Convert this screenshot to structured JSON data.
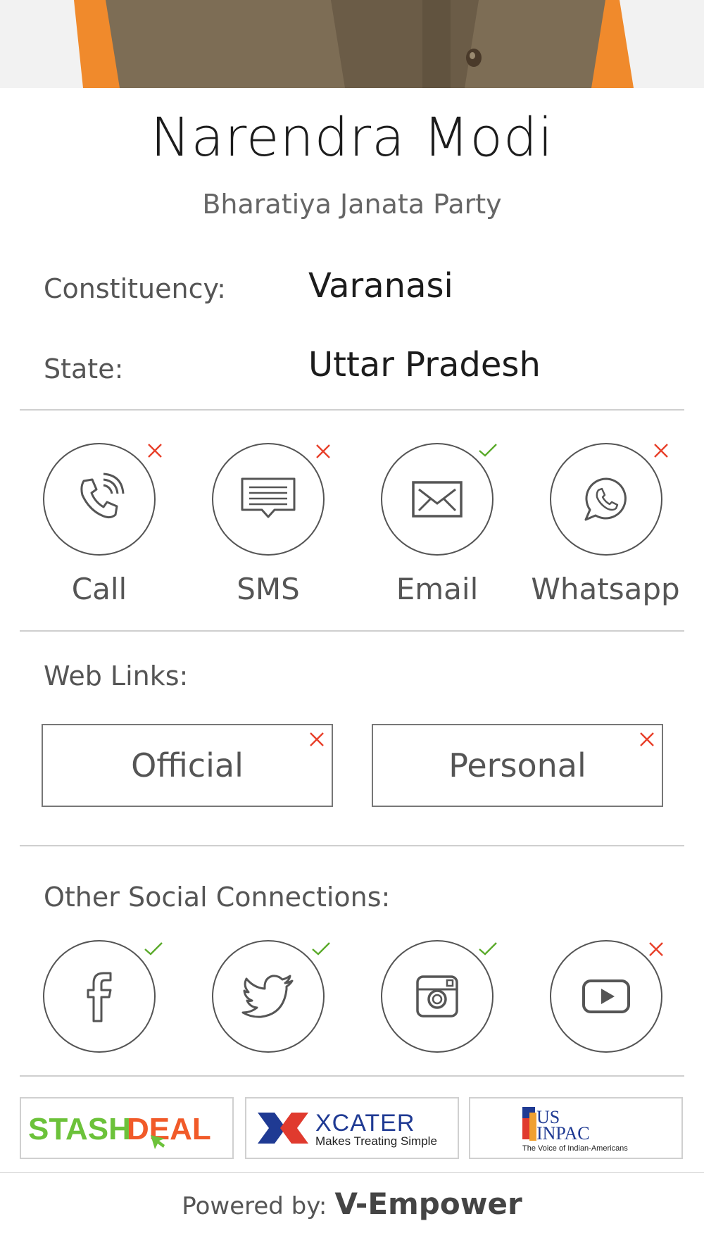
{
  "profile": {
    "name": "Narendra Modi",
    "party": "Bharatiya Janata Party",
    "constituency_label": "Constituency:",
    "constituency_value": "Varanasi",
    "state_label": "State:",
    "state_value": "Uttar Pradesh"
  },
  "contact": {
    "items": [
      {
        "label": "Call",
        "icon": "phone-icon",
        "available": false
      },
      {
        "label": "SMS",
        "icon": "sms-icon",
        "available": false
      },
      {
        "label": "Email",
        "icon": "envelope-icon",
        "available": true
      },
      {
        "label": "Whatsapp",
        "icon": "whatsapp-icon",
        "available": false
      }
    ]
  },
  "web_links": {
    "title": "Web Links:",
    "official_label": "Official",
    "official_available": false,
    "personal_label": "Personal",
    "personal_available": false
  },
  "social": {
    "title": "Other Social Connections:",
    "items": [
      {
        "icon": "facebook-icon",
        "available": true
      },
      {
        "icon": "twitter-icon",
        "available": true
      },
      {
        "icon": "instagram-icon",
        "available": true
      },
      {
        "icon": "youtube-icon",
        "available": false
      }
    ]
  },
  "sponsors": {
    "stashdeal_a": "STASH",
    "stashdeal_b": "DEAL",
    "xcater_name": "XCATER",
    "xcater_tagline": "Makes Treating Simple",
    "usinpac_line1": "US",
    "usinpac_line2": "INPAC",
    "usinpac_tagline": "The Voice of Indian-Americans"
  },
  "footer": {
    "powered_by": "Powered by:",
    "brand": "V-Empower"
  },
  "colors": {
    "available": "#5aaa2a",
    "unavailable": "#e8402a",
    "stash_green": "#6cc23a",
    "stash_orange": "#f15a29",
    "xcater_blue": "#1f3a93",
    "xcater_red": "#e03a2e"
  }
}
